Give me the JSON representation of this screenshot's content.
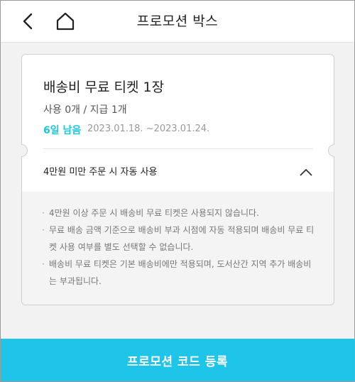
{
  "header": {
    "title": "프로모션 박스"
  },
  "ticket": {
    "title": "배송비 무료 티켓 1장",
    "usage": "사용 0개 / 지급 1개",
    "remaining": "6일 남음",
    "period": "2023.01.18. ~2023.01.24.",
    "condition": "4만원 미만 주문 시 자동 사용",
    "notices": [
      "4만원 이상 주문 시 배송비 무료 티켓은 사용되지 않습니다.",
      "무료 배송 금액 기준으로 배송비 부과 시점에 자동 적용되며 배송비 무료 티켓 사용 여부를 별도 선택할 수 없습니다.",
      "배송비 무료 티켓은 기본 배송비에만 적용되며, 도서산간 지역 추가 배송비는 부과됩니다."
    ],
    "bullet": "·"
  },
  "footer": {
    "button_label": "프로모션 코드 등록"
  },
  "colors": {
    "accent": "#1ec5e8",
    "remaining_text": "#1cc8dc"
  },
  "icons": {
    "back": "back-arrow-icon",
    "home": "home-icon",
    "toggle": "chevron-up-icon"
  }
}
